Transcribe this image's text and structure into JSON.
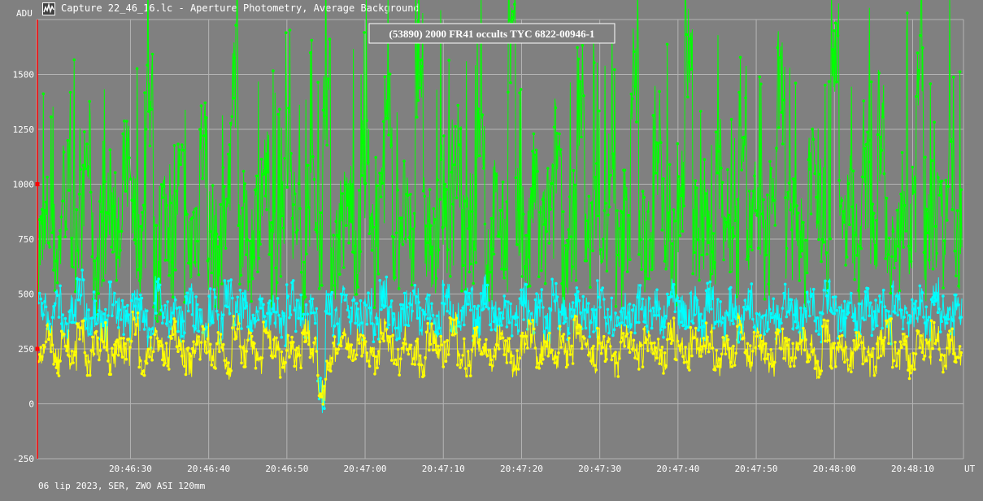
{
  "window": {
    "title": "Capture 22_46_16.lc - Aperture Photometry, Average Background",
    "icon": "lightcurve-app-icon"
  },
  "footer": {
    "text": "06 lip 2023, SER, ZWO ASI 120mm"
  },
  "colors": {
    "background": "#808080",
    "grid": "#b4b4b4",
    "occulted": "#ffff00",
    "comparison1": "#00ff00",
    "comparison2": "#00ffff",
    "cursor": "#ff0000",
    "text": "#ffffff"
  },
  "chart_data": {
    "type": "line",
    "title": "(53890) 2000 FR41 occults TYC 6822-00946-1",
    "xlabel": "UT",
    "ylabel": "ADU",
    "x_start": "20:46:18",
    "x_end": "20:48:16",
    "xlim_seconds": [
      0,
      118.5
    ],
    "ylim": [
      -250,
      1750
    ],
    "y_ticks": [
      -250,
      0,
      250,
      500,
      750,
      1000,
      1250,
      1500
    ],
    "x_ticks": [
      "20:46:30",
      "20:46:40",
      "20:46:50",
      "20:47:00",
      "20:47:10",
      "20:47:20",
      "20:47:30",
      "20:47:40",
      "20:47:50",
      "20:48:00",
      "20:48:10"
    ],
    "grid": true,
    "legend": "none",
    "cursor_x_seconds": 0,
    "sample_interval_seconds": 0.1,
    "series": [
      {
        "color": "#00ff00",
        "values": [
          720,
          820,
          690,
          980,
          760,
          850,
          1120,
          640,
          780,
          910,
          700,
          1050,
          830,
          760,
          1380,
          620,
          880,
          740,
          990,
          700,
          820,
          1180,
          760,
          680,
          930,
          1510,
          800,
          720,
          860,
          1020,
          690,
          770,
          1230,
          840,
          650,
          960,
          780,
          1420,
          710,
          830,
          900,
          740,
          1080,
          680,
          820,
          1300,
          760,
          880,
          700,
          1560,
          790,
          650,
          960,
          840,
          1110,
          720,
          800,
          1250,
          690,
          870,
          760,
          1640,
          820,
          700,
          980,
          750,
          880,
          1150,
          680,
          810,
          1390,
          740,
          900,
          770,
          1020,
          660,
          850,
          1480,
          720,
          790,
          1200,
          830,
          700,
          940,
          1590,
          760,
          860,
          690,
          1050,
          820,
          730,
          1320,
          780,
          880,
          710,
          960,
          1440,
          750,
          820,
          680,
          1120,
          870,
          740,
          1660,
          790,
          900,
          720,
          1010,
          830,
          1270,
          760,
          690,
          940,
          820,
          1530,
          710,
          860,
          780,
          1080,
          740
        ]
      },
      {
        "color": "#00ffff",
        "values": [
          430,
          380,
          460,
          350,
          410,
          520,
          390,
          440,
          360,
          480,
          400,
          370,
          450,
          420,
          340,
          500,
          390,
          430,
          360,
          470,
          410,
          380,
          440,
          350,
          490,
          400,
          430,
          370,
          460,
          390,
          420,
          350,
          480,
          410,
          380,
          450,
          30,
          430,
          360,
          470,
          400,
          380,
          440,
          350,
          490,
          410,
          370,
          430,
          460,
          390,
          420,
          350,
          480,
          400,
          380,
          450,
          360,
          510,
          410,
          380,
          440,
          370,
          470,
          390,
          430,
          360,
          480,
          420,
          380,
          450,
          400,
          360,
          490,
          410,
          380,
          440,
          370,
          460,
          400,
          430,
          360,
          480,
          410,
          390,
          450,
          370,
          500,
          400,
          380,
          440,
          360,
          470,
          410,
          390,
          430,
          370,
          480,
          400,
          380,
          450,
          360,
          490,
          410,
          380,
          440,
          370,
          460,
          400,
          430,
          360,
          480,
          420,
          390,
          450,
          370,
          500,
          410,
          380,
          440
        ]
      },
      {
        "color": "#ffff00",
        "values": [
          240,
          300,
          180,
          270,
          220,
          330,
          190,
          260,
          310,
          200,
          280,
          230,
          350,
          180,
          250,
          290,
          210,
          320,
          240,
          190,
          270,
          300,
          220,
          260,
          180,
          340,
          230,
          280,
          200,
          310,
          250,
          190,
          270,
          220,
          330,
          240,
          60,
          180,
          260,
          300,
          210,
          280,
          230,
          190,
          320,
          250,
          200,
          290,
          240,
          180,
          310,
          260,
          220,
          350,
          230,
          190,
          280,
          250,
          210,
          300,
          240,
          180,
          270,
          320,
          220,
          260,
          190,
          290,
          230,
          340,
          250,
          200,
          280,
          240,
          180,
          310,
          260,
          220,
          290,
          230,
          190,
          330,
          250,
          210,
          280,
          240,
          300,
          190,
          260,
          230,
          350,
          210,
          280,
          250,
          190,
          310,
          240,
          220,
          290,
          260,
          180,
          320,
          230,
          250,
          200,
          300,
          240,
          190,
          270,
          330,
          220,
          260,
          180,
          290,
          240,
          310,
          210,
          280,
          230
        ]
      }
    ]
  }
}
